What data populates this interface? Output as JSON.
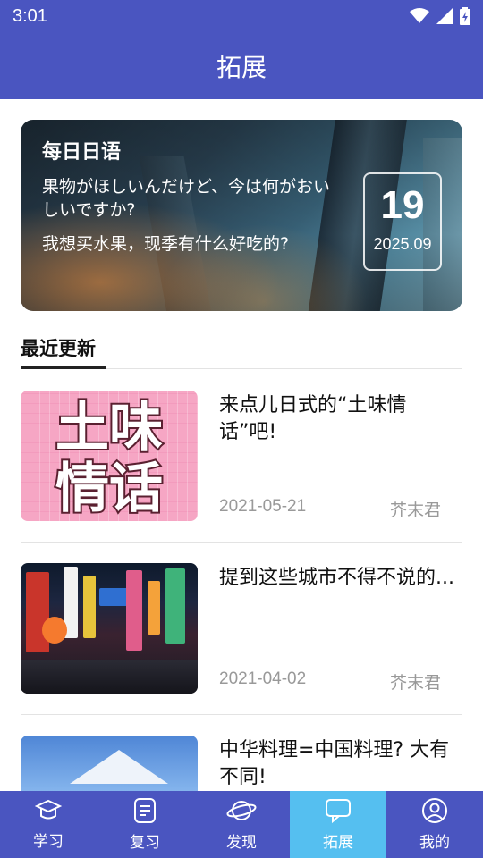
{
  "status_bar": {
    "time": "3:01"
  },
  "app_bar": {
    "title": "拓展"
  },
  "daily_card": {
    "heading": "每日日语",
    "japanese": "果物がほしいんだけど、今は何がおいしいですか?",
    "chinese": "我想买水果，现季有什么好吃的?",
    "day": "19",
    "year_month": "2025.09"
  },
  "section": {
    "title": "最近更新"
  },
  "articles": [
    {
      "title": "来点儿日式的“土味情话”吧!",
      "date": "2021-05-21",
      "author": "芥末君",
      "thumb_text": [
        "土味",
        "情话"
      ]
    },
    {
      "title": "提到这些城市不得不说的...",
      "date": "2021-04-02",
      "author": "芥末君"
    },
    {
      "title": "中华料理=中国料理? 大有不同!"
    }
  ],
  "bottom_nav": [
    {
      "label": "学习",
      "icon": "graduation-cap-icon"
    },
    {
      "label": "复习",
      "icon": "document-icon"
    },
    {
      "label": "发现",
      "icon": "planet-icon"
    },
    {
      "label": "拓展",
      "icon": "chat-bubble-icon",
      "active": true
    },
    {
      "label": "我的",
      "icon": "user-icon"
    }
  ],
  "colors": {
    "primary": "#4a55c0",
    "active_tab": "#55bff0"
  }
}
